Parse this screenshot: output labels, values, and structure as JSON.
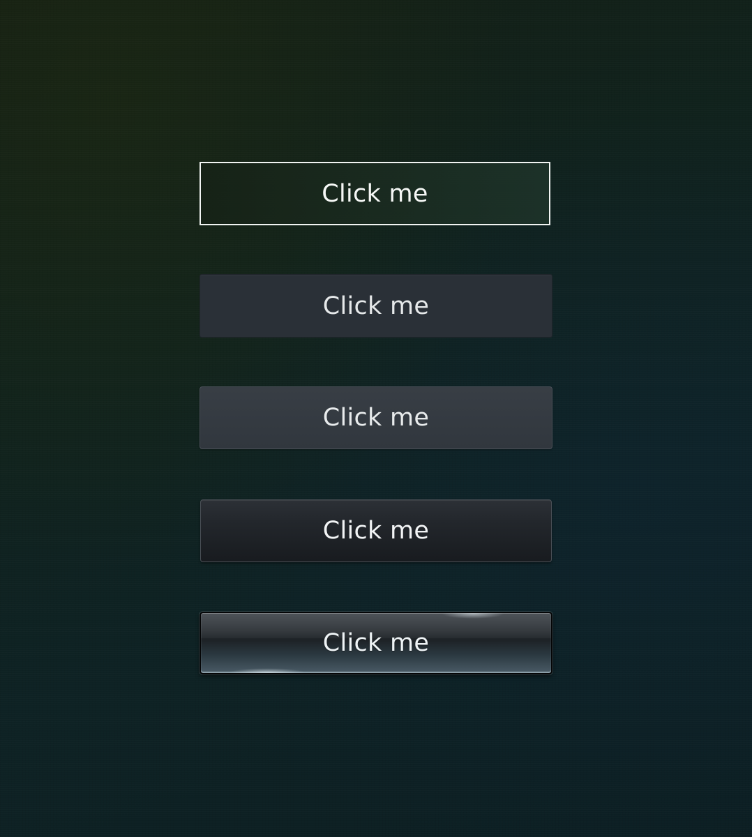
{
  "buttons": [
    {
      "label": "Click me",
      "style": "outline"
    },
    {
      "label": "Click me",
      "style": "flat-dark"
    },
    {
      "label": "Click me",
      "style": "flat-soft"
    },
    {
      "label": "Click me",
      "style": "dark-gradient"
    },
    {
      "label": "Click me",
      "style": "glossy-glass"
    }
  ],
  "colors": {
    "background": "#10221d",
    "text": "#eef1f2",
    "outline_border": "#f1f4f2"
  }
}
